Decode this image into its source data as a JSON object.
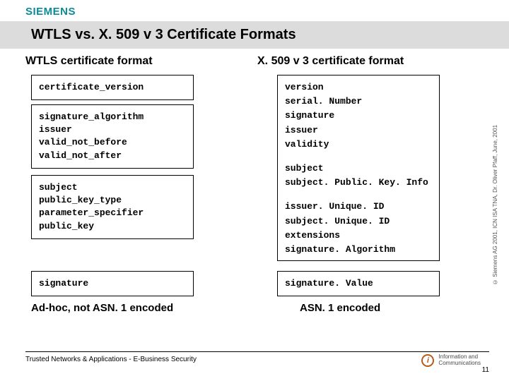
{
  "brand": "SIEMENS",
  "title": "WTLS vs. X. 509 v 3 Certificate Formats",
  "left": {
    "heading": "WTLS certificate format",
    "box1": [
      "certificate_version"
    ],
    "box2": [
      "signature_algorithm",
      "issuer",
      "valid_not_before",
      "valid_not_after"
    ],
    "box3": [
      "subject",
      "public_key_type",
      "parameter_specifier",
      "public_key"
    ],
    "box4": [
      "signature"
    ],
    "caption": "Ad-hoc, not ASN. 1 encoded"
  },
  "right": {
    "heading": "X. 509 v 3 certificate format",
    "box1_groups": [
      [
        "version",
        "serial. Number",
        "signature",
        "issuer",
        "validity"
      ],
      [
        "subject",
        "subject. Public. Key. Info"
      ],
      [
        "issuer. Unique. ID",
        "subject. Unique. ID",
        "extensions",
        "signature. Algorithm"
      ]
    ],
    "box2": [
      "signature. Value"
    ],
    "caption": "ASN. 1 encoded"
  },
  "copyright": "© Siemens AG 2001, ICN ISA TNA, Dr. Oliver Pfaff, June, 2001",
  "footer": {
    "left": "Trusted Networks & Applications - E-Business Security",
    "ic_label": "Information and",
    "ic_label2": "Communications",
    "page": "11"
  }
}
